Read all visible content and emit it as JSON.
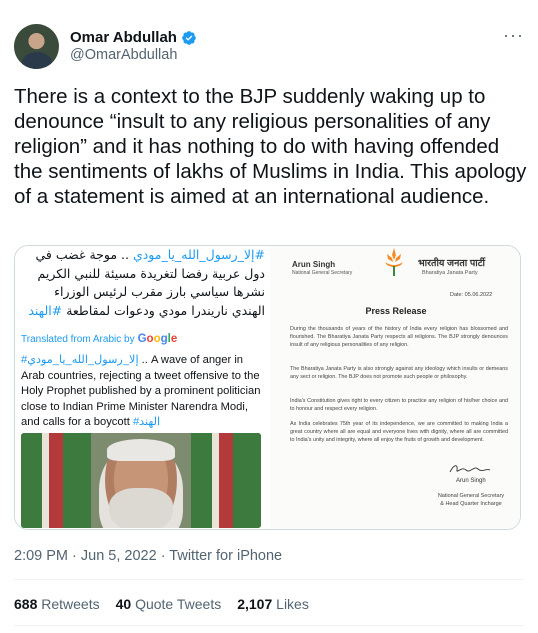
{
  "author": {
    "display_name": "Omar Abdullah",
    "handle": "@OmarAbdullah",
    "verified": true
  },
  "tweet": {
    "text": "There is a context to the BJP suddenly waking up to denounce “insult to any religious personalities of any religion” and it has nothing to do with having offended the sentiments of lakhs of Muslims in India. This apology of a statement is aimed at an international audience."
  },
  "quoted_media": {
    "arabic_tag_1": "#إلا_رسول_الله_يا_مودي",
    "arabic_text_1": ".. موجة غضب في دول عربية رفضا لتغريدة مسيئة للنبي الكريم نشرها سياسي بارز مقرب لرئيس الوزراء الهندي ناريندرا مودي ودعوات لمقاطعة",
    "arabic_tag_2": "#الهند",
    "translated_label": "Translated from Arabic by",
    "google": {
      "g": "G",
      "o1": "o",
      "o2": "o",
      "g2": "g",
      "l": "l",
      "e": "e"
    },
    "translation_tag_1": "#إلا_رسول_الله_يا_مودي",
    "translation_text": ".. A wave of anger in Arab countries, rejecting a tweet offensive to the Holy Prophet published by a prominent politician close to Indian Prime Minister Narendra Modi, and calls for a boycott",
    "translation_tag_2": "#الهند"
  },
  "press_release": {
    "left_name": "Arun Singh",
    "left_sub": "National General Secretary",
    "party_hindi": "भारतीय जनता पार्टी",
    "party_english": "Bharatiya Janata Party",
    "date": "Date: 05.06.2022",
    "title": "Press Release",
    "paragraphs": [
      "During the thousands of years of the history of India every religion has blossomed and flourished. The Bharatiya Janata Party respects all religions. The BJP strongly denounces insult of any religious personalities of any religion.",
      "The Bharatiya Janata Party is also strongly against any ideology which insults or demeans any sect or religion. The BJP does not promote such people or philosophy.",
      "India's Constitution gives right to every citizen to practice any religion of his/her choice and to honour and respect every religion.",
      "As India celebrates 75th year of its independence, we are committed to making India a great country where all are equal and everyone lives with dignity, where all are committed to India's unity and integrity, where all enjoy the fruits of growth and development."
    ],
    "sign_name": "Arun Singh",
    "sign_title_1": "National General Secretary",
    "sign_title_2": "& Head Quarter Incharge"
  },
  "meta": {
    "timestamp": "2:09 PM · Jun 5, 2022 · Twitter for iPhone"
  },
  "stats": {
    "retweets_count": "688",
    "retweets_label": "Retweets",
    "quotes_count": "40",
    "quotes_label": "Quote Tweets",
    "likes_count": "2,107",
    "likes_label": "Likes"
  },
  "colors": {
    "accent": "#1d9bf0",
    "secondary_text": "#536471",
    "primary_text": "#0f1419"
  },
  "icons": {
    "verified": "verified-badge-icon",
    "more": "more-options-icon"
  }
}
